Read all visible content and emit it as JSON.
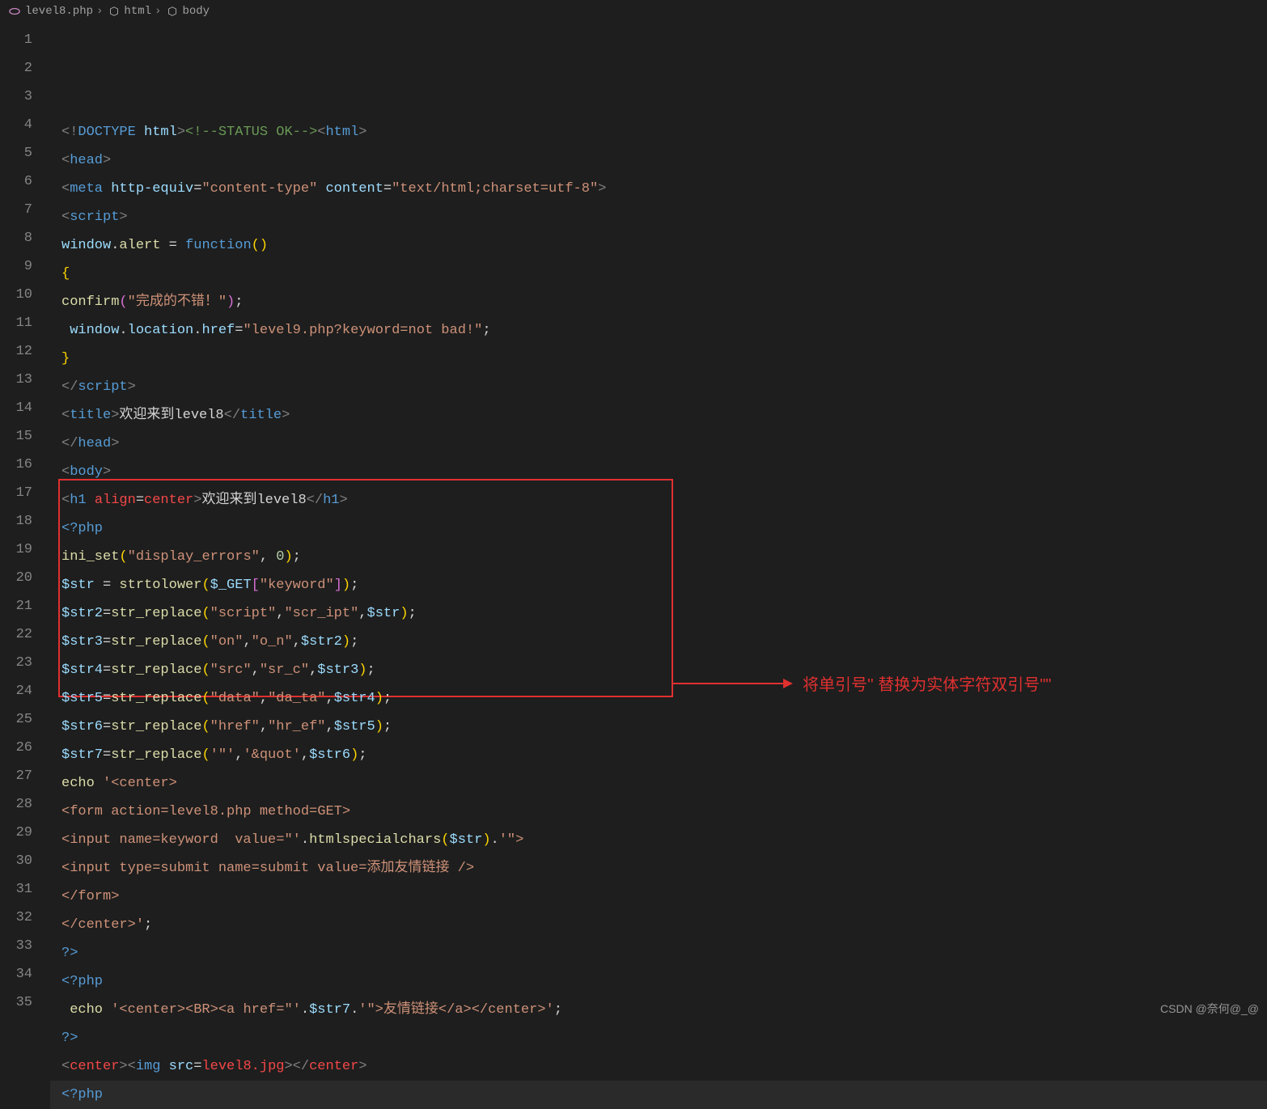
{
  "breadcrumb": {
    "file": "level8.php",
    "path": [
      "html",
      "body"
    ]
  },
  "annotation": {
    "text": "将单引号'' 替换为实体字符双引号\"\""
  },
  "watermark": "CSDN @奈何@_@",
  "lines": [
    {
      "n": 1,
      "html": "<span class='gray'>&lt;!</span><span class='tag'>DOCTYPE</span> <span class='attr'>html</span><span class='gray'>&gt;</span><span class='comm'>&lt;!--STATUS OK--&gt;</span><span class='gray'>&lt;</span><span class='tag'>html</span><span class='gray'>&gt;</span>"
    },
    {
      "n": 2,
      "html": "<span class='gray'>&lt;</span><span class='tag'>head</span><span class='gray'>&gt;</span>"
    },
    {
      "n": 3,
      "html": "<span class='gray'>&lt;</span><span class='tag'>meta</span> <span class='attr'>http-equiv</span><span class='white'>=</span><span class='str'>\"content-type\"</span> <span class='attr'>content</span><span class='white'>=</span><span class='str'>\"text/html;charset=utf-8\"</span><span class='gray'>&gt;</span>"
    },
    {
      "n": 4,
      "html": "<span class='gray'>&lt;</span><span class='tag'>script</span><span class='gray'>&gt;</span>"
    },
    {
      "n": 5,
      "html": "<span class='id'>window</span><span class='white'>.</span><span class='fn'>alert</span> <span class='white'>=</span> <span class='kw'>function</span><span class='brace1'>()</span>"
    },
    {
      "n": 6,
      "html": "<span class='brace1'>{</span>"
    },
    {
      "n": 7,
      "html": "<span class='fn'>confirm</span><span class='brace2'>(</span><span class='str'>\"完成的不错！\"</span><span class='brace2'>)</span><span class='white'>;</span>"
    },
    {
      "n": 8,
      "html": " <span class='id'>window</span><span class='white'>.</span><span class='id'>location</span><span class='white'>.</span><span class='id'>href</span><span class='white'>=</span><span class='str'>\"level9.php?keyword=not bad!\"</span><span class='white'>;</span>"
    },
    {
      "n": 9,
      "html": "<span class='brace1'>}</span>"
    },
    {
      "n": 10,
      "html": "<span class='gray'>&lt;/</span><span class='tag'>script</span><span class='gray'>&gt;</span>"
    },
    {
      "n": 11,
      "html": "<span class='gray'>&lt;</span><span class='tag'>title</span><span class='gray'>&gt;</span><span class='white'>欢迎来到level8</span><span class='gray'>&lt;/</span><span class='tag'>title</span><span class='gray'>&gt;</span>"
    },
    {
      "n": 12,
      "html": "<span class='gray'>&lt;/</span><span class='tag'>head</span><span class='gray'>&gt;</span>"
    },
    {
      "n": 13,
      "html": "<span class='gray'>&lt;</span><span class='tag'>body</span><span class='gray'>&gt;</span>"
    },
    {
      "n": 14,
      "html": "<span class='gray'>&lt;</span><span class='tag'>h1</span> <span class='redtag'>align</span><span class='white'>=</span><span class='redtag'>center</span><span class='gray'>&gt;</span><span class='white'>欢迎来到level8</span><span class='gray'>&lt;/</span><span class='tag'>h1</span><span class='gray'>&gt;</span>"
    },
    {
      "n": 15,
      "html": "<span class='tag'>&lt;?php</span>"
    },
    {
      "n": 16,
      "html": "<span class='fn'>ini_set</span><span class='brace1'>(</span><span class='str'>\"display_errors\"</span><span class='white'>, </span><span class='num'>0</span><span class='brace1'>)</span><span class='white'>;</span>"
    },
    {
      "n": 17,
      "html": "<span class='id'>$str</span> <span class='white'>=</span> <span class='fn'>strtolower</span><span class='brace1'>(</span><span class='id'>$_GET</span><span class='brace2'>[</span><span class='str'>\"keyword\"</span><span class='brace2'>]</span><span class='brace1'>)</span><span class='white'>;</span>"
    },
    {
      "n": 18,
      "html": "<span class='id'>$str2</span><span class='white'>=</span><span class='fn'>str_replace</span><span class='brace1'>(</span><span class='str'>\"script\"</span><span class='white'>,</span><span class='str'>\"scr_ipt\"</span><span class='white'>,</span><span class='id'>$str</span><span class='brace1'>)</span><span class='white'>;</span>"
    },
    {
      "n": 19,
      "html": "<span class='id'>$str3</span><span class='white'>=</span><span class='fn'>str_replace</span><span class='brace1'>(</span><span class='str'>\"on\"</span><span class='white'>,</span><span class='str'>\"o_n\"</span><span class='white'>,</span><span class='id'>$str2</span><span class='brace1'>)</span><span class='white'>;</span>"
    },
    {
      "n": 20,
      "html": "<span class='id'>$str4</span><span class='white'>=</span><span class='fn'>str_replace</span><span class='brace1'>(</span><span class='str'>\"src\"</span><span class='white'>,</span><span class='str'>\"sr_c\"</span><span class='white'>,</span><span class='id'>$str3</span><span class='brace1'>)</span><span class='white'>;</span>"
    },
    {
      "n": 21,
      "html": "<span class='id'>$str5</span><span class='white'>=</span><span class='fn'>str_replace</span><span class='brace1'>(</span><span class='str'>\"data\"</span><span class='white'>,</span><span class='str'>\"da_ta\"</span><span class='white'>,</span><span class='id'>$str4</span><span class='brace1'>)</span><span class='white'>;</span>"
    },
    {
      "n": 22,
      "html": "<span class='id'>$str6</span><span class='white'>=</span><span class='fn'>str_replace</span><span class='brace1'>(</span><span class='str'>\"href\"</span><span class='white'>,</span><span class='str'>\"hr_ef\"</span><span class='white'>,</span><span class='id'>$str5</span><span class='brace1'>)</span><span class='white'>;</span>"
    },
    {
      "n": 23,
      "html": "<span class='id'>$str7</span><span class='white'>=</span><span class='fn'>str_replace</span><span class='brace1'>(</span><span class='str'>'\"'</span><span class='white'>,</span><span class='str'>'&amp;quot'</span><span class='white'>,</span><span class='id'>$str6</span><span class='brace1'>)</span><span class='white'>;</span>"
    },
    {
      "n": 24,
      "html": "<span class='fn'>echo</span> <span class='str'>'&lt;center&gt;</span>"
    },
    {
      "n": 25,
      "html": "<span class='str'>&lt;form action=level8.php method=GET&gt;</span>"
    },
    {
      "n": 26,
      "html": "<span class='str'>&lt;input name=keyword  value=\"'</span><span class='white'>.</span><span class='fn'>htmlspecialchars</span><span class='brace1'>(</span><span class='id'>$str</span><span class='brace1'>)</span><span class='white'>.</span><span class='str'>'\"&gt;</span>"
    },
    {
      "n": 27,
      "html": "<span class='str'>&lt;input type=submit name=submit value=添加友情链接 /&gt;</span>"
    },
    {
      "n": 28,
      "html": "<span class='str'>&lt;/form&gt;</span>"
    },
    {
      "n": 29,
      "html": "<span class='str'>&lt;/center&gt;'</span><span class='white'>;</span>"
    },
    {
      "n": 30,
      "html": "<span class='tag'>?&gt;</span>"
    },
    {
      "n": 31,
      "html": "<span class='tag'>&lt;?php</span>"
    },
    {
      "n": 32,
      "html": " <span class='fn'>echo</span> <span class='str'>'&lt;center&gt;&lt;BR&gt;&lt;a href=\"'</span><span class='white'>.</span><span class='id'>$str7</span><span class='white'>.</span><span class='str'>'\"&gt;友情链接&lt;/a&gt;&lt;/center&gt;'</span><span class='white'>;</span>"
    },
    {
      "n": 33,
      "html": "<span class='tag'>?&gt;</span>"
    },
    {
      "n": 34,
      "html": "<span class='gray'>&lt;</span><span class='redtag'>center</span><span class='gray'>&gt;&lt;</span><span class='tag'>img</span> <span class='attr'>src</span><span class='white'>=</span><span class='redtag'>level8.jpg</span><span class='gray'>&gt;&lt;/</span><span class='redtag'>center</span><span class='gray'>&gt;</span>"
    },
    {
      "n": 35,
      "html": "<span class='tag'>&lt;?php</span>"
    }
  ]
}
